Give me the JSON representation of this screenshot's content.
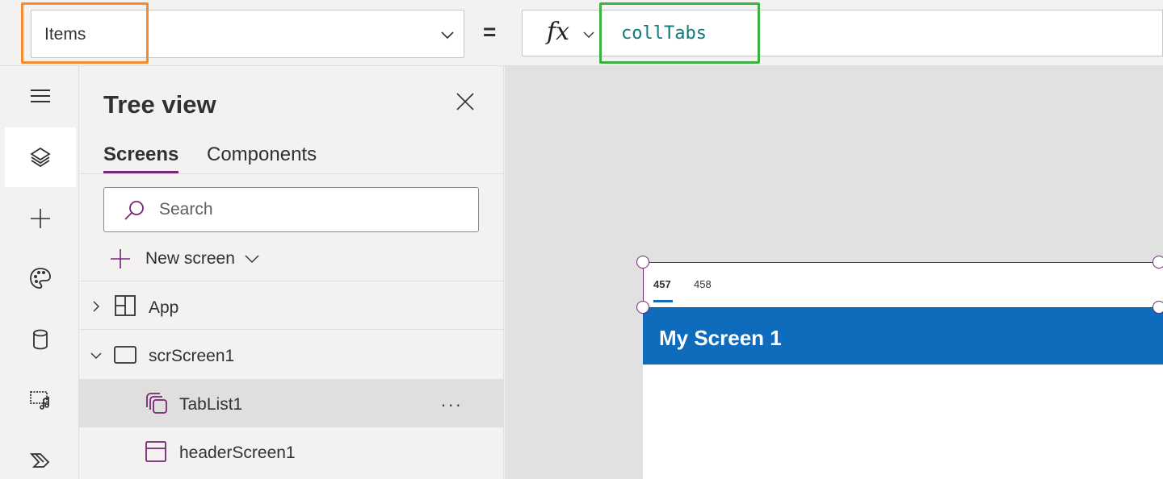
{
  "formula_bar": {
    "property": "Items",
    "equals": "=",
    "fx": "fx",
    "formula": "collTabs"
  },
  "rail": {
    "items": [
      "menu-icon",
      "layers-icon",
      "add-icon",
      "theme-icon",
      "data-icon",
      "media-icon",
      "power-automate-icon"
    ],
    "active": "layers-icon"
  },
  "tree_view": {
    "title": "Tree view",
    "tabs": [
      {
        "label": "Screens",
        "active": true
      },
      {
        "label": "Components",
        "active": false
      }
    ],
    "search_placeholder": "Search",
    "new_screen_label": "New screen",
    "nodes": [
      {
        "label": "App",
        "icon": "app-icon",
        "expander": "collapsed"
      },
      {
        "label": "scrScreen1",
        "icon": "screen-icon",
        "expander": "expanded"
      },
      {
        "label": "TabList1",
        "icon": "gallery-icon",
        "selected": true,
        "more": "..."
      },
      {
        "label": "headerScreen1",
        "icon": "header-icon"
      }
    ]
  },
  "canvas": {
    "tabs": [
      "457",
      "458"
    ],
    "active_tab": "457",
    "header_title": "My Screen 1"
  },
  "colors": {
    "accent_purple": "#742774",
    "header_blue": "#0f6cbd",
    "highlight_orange": "#f58a2f",
    "highlight_green": "#3cb043",
    "formula_text": "#0e7a7a"
  }
}
